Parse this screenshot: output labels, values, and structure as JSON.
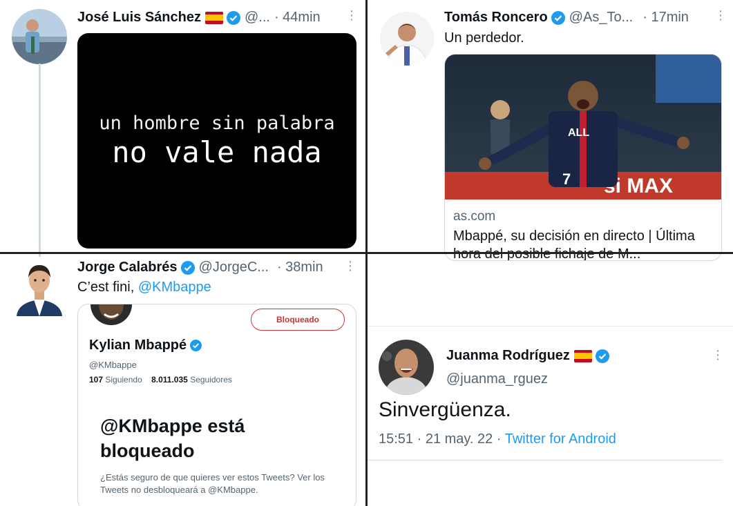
{
  "tweet_tl": {
    "name": "José Luis Sánchez",
    "handle": "@...",
    "time": "· 44min",
    "image_line1": "un hombre sin palabra",
    "image_line2": "no vale nada"
  },
  "tweet_tr": {
    "name": "Tomás Roncero",
    "handle": "@As_To...",
    "time": "· 17min",
    "text": "Un perdedor.",
    "card_domain": "as.com",
    "card_title": "Mbappé, su decisión en directo | Última hora del posible fichaje de M...",
    "jersey_sponsor": "ALL",
    "jersey_number": "7",
    "board_text": "si MAX"
  },
  "tweet_bl": {
    "name": "Jorge Calabrés",
    "handle": "@JorgeC...",
    "time": "· 38min",
    "text_prefix": "C’est fini, ",
    "mention": "@KMbappe",
    "profile": {
      "button": "Bloqueado",
      "name": "Kylian Mbappé",
      "handle": "@KMbappe",
      "following_count": "107",
      "following_label": "Siguiendo",
      "followers_count": "8.011.035",
      "followers_label": "Seguidores",
      "blocked_title": "@KMbappe está bloqueado",
      "blocked_note": "¿Estás seguro de que quieres ver estos Tweets? Ver los Tweets no desbloqueará a @KMbappe."
    }
  },
  "tweet_br": {
    "name": "Juanma Rodríguez",
    "handle": "@juanma_rguez",
    "text": "Sinvergüenza.",
    "timestamp": "15:51 · 21 may. 22 · ",
    "source": "Twitter for Android"
  },
  "colors": {
    "link": "#1d9bf0",
    "verified": "#1d9bf0",
    "blocked": "#c7343a",
    "divider": "#222222"
  }
}
